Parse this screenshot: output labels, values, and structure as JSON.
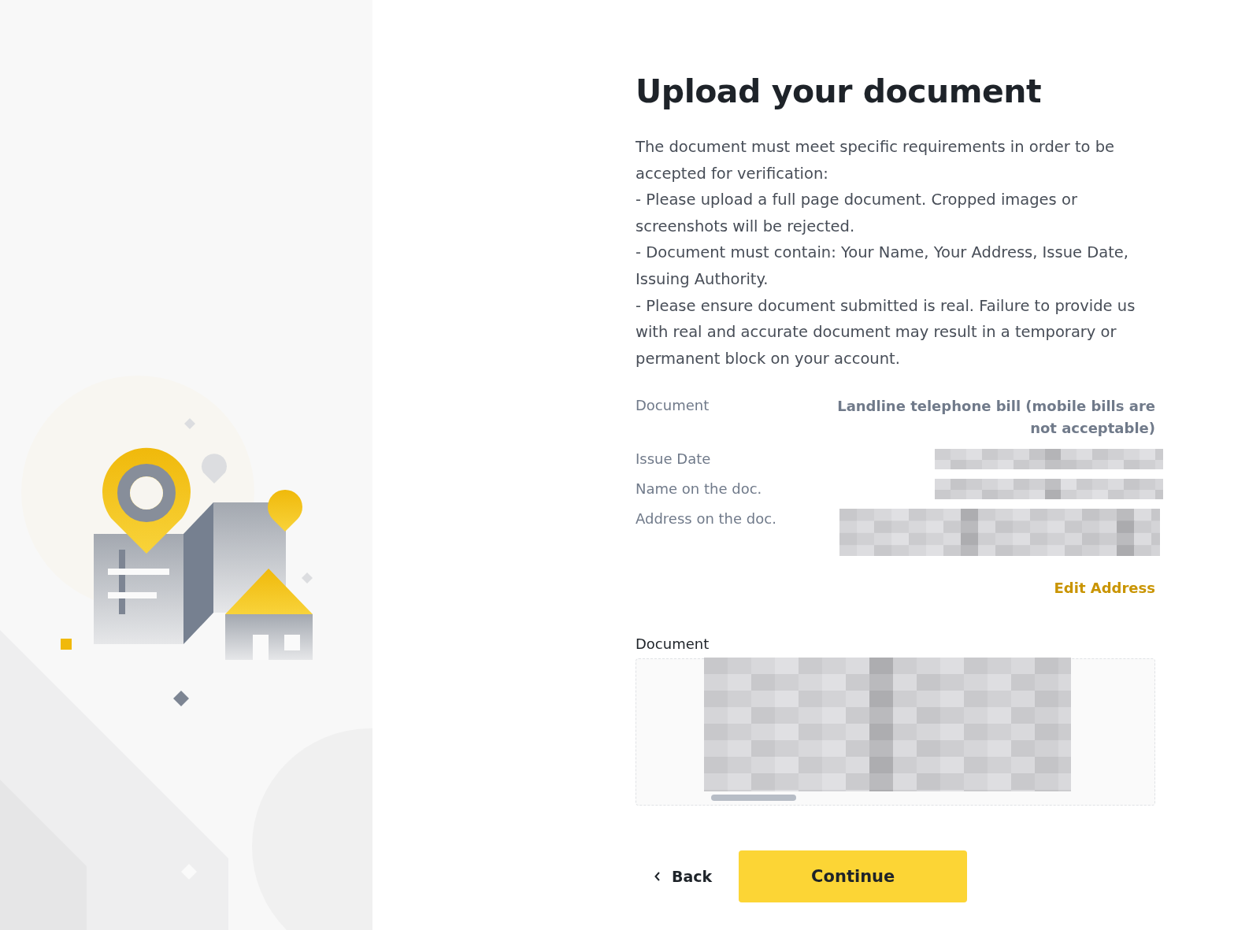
{
  "title": "Upload your document",
  "instructions": [
    "The document must meet specific requirements in order to be accepted for verification:",
    "- Please upload a full page document. Cropped images or screenshots will be rejected.",
    "- Document must contain: Your Name, Your Address, Issue Date, Issuing Authority.",
    "- Please ensure document submitted is real. Failure to provide us with real and accurate document may result in a temporary or permanent block on your account."
  ],
  "details": [
    {
      "label": "Document",
      "kind": "text",
      "value": "Landline telephone bill (mobile bills are not acceptable)"
    },
    {
      "label": "Issue Date",
      "kind": "blurred"
    },
    {
      "label": "Name on the doc.",
      "kind": "blurred"
    },
    {
      "label": "Address on the doc.",
      "kind": "blurred_tall"
    }
  ],
  "edit_link": "Edit Address",
  "upload": {
    "label": "Document"
  },
  "buttons": {
    "back": "Back",
    "continue": "Continue"
  }
}
